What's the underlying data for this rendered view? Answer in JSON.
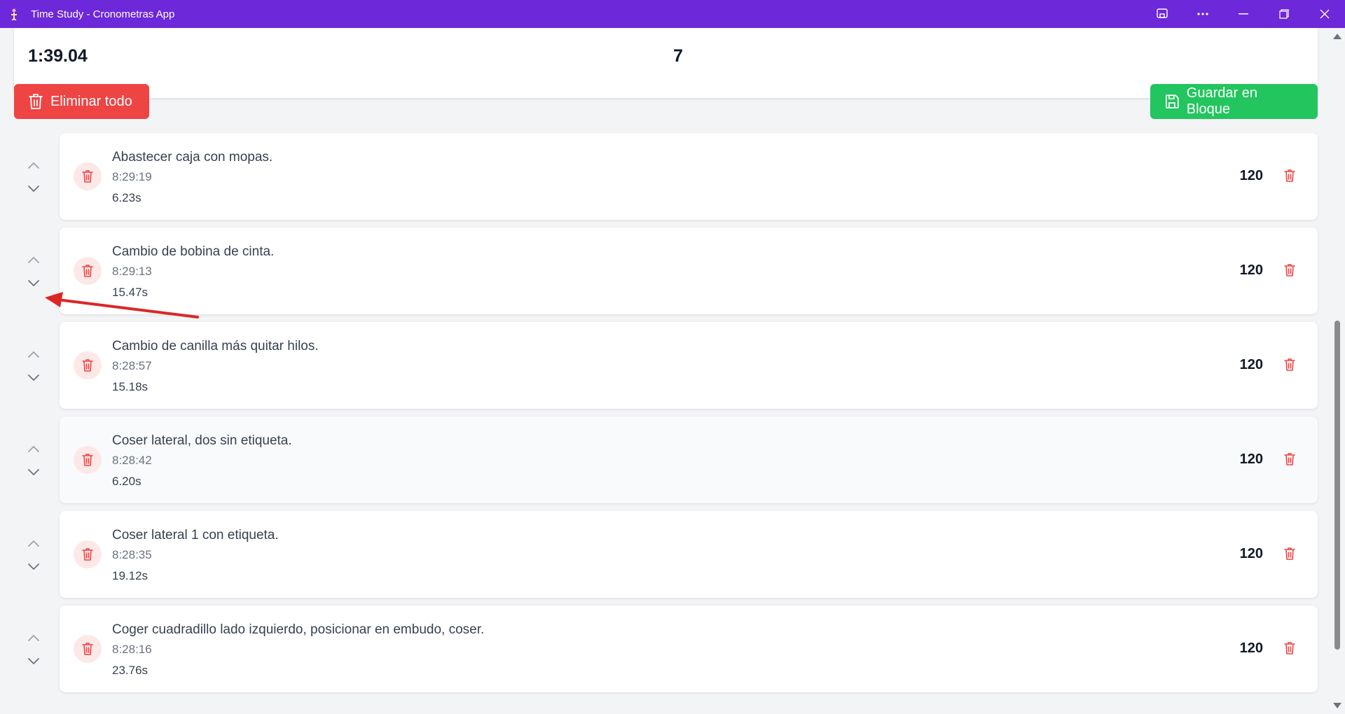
{
  "window": {
    "title": "Time Study - Cronometras App"
  },
  "summary": {
    "total_time": "1:39.04",
    "count": "7"
  },
  "toolbar": {
    "delete_all_label": "Eliminar todo",
    "save_block_label": "Guardar en Bloque"
  },
  "colors": {
    "titlebar": "#6d28d9",
    "danger": "#ef4444",
    "success": "#22c55e"
  },
  "steps": [
    {
      "name": "Abastecer caja con mopas.",
      "time": "8:29:19",
      "duration": "6.23s",
      "value": "120"
    },
    {
      "name": "Cambio de bobina de cinta.",
      "time": "8:29:13",
      "duration": "15.47s",
      "value": "120"
    },
    {
      "name": "Cambio de canilla más quitar hilos.",
      "time": "8:28:57",
      "duration": "15.18s",
      "value": "120"
    },
    {
      "name": "Coser lateral, dos sin etiqueta.",
      "time": "8:28:42",
      "duration": "6.20s",
      "value": "120"
    },
    {
      "name": "Coser lateral 1 con etiqueta.",
      "time": "8:28:35",
      "duration": "19.12s",
      "value": "120"
    },
    {
      "name": "Coger cuadradillo lado izquierdo, posicionar en embudo, coser.",
      "time": "8:28:16",
      "duration": "23.76s",
      "value": "120"
    }
  ]
}
